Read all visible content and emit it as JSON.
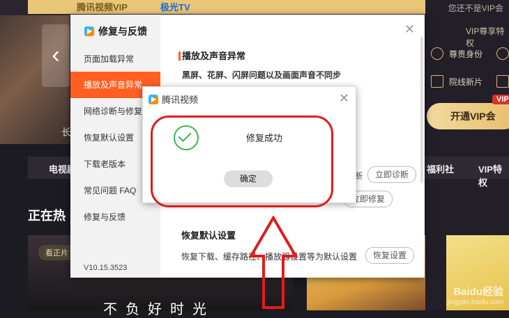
{
  "background": {
    "banner_logo_1": "腾讯视频VIP",
    "banner_logo_2": "极光TV",
    "carousel_caption": "长",
    "vip_hint": "您还不是VIP会",
    "vip_section_title": "VIP尊享特权",
    "vip_rows": [
      {
        "label": "尊贵身份"
      },
      {
        "label": "院线新片"
      }
    ],
    "vip_button": "开通VIP会",
    "vip_tag": "VIP",
    "tabs": [
      "电视剧",
      "福利社",
      "VIP特权"
    ],
    "hot_title": "正在热",
    "watch_badge": "看正片",
    "caption": "不负好时光",
    "watermark_main": "Baidu经验",
    "watermark_sub": "jingyan.baidu.com"
  },
  "dialog": {
    "title": "修复与反馈",
    "nav": [
      {
        "label": "页面加载异常"
      },
      {
        "label": "播放及声音异常"
      },
      {
        "label": "网络诊断与修复"
      },
      {
        "label": "恢复默认设置"
      },
      {
        "label": "下载老版本"
      },
      {
        "label": "常见问题 FAQ"
      },
      {
        "label": "修复与反馈"
      }
    ],
    "version": "V10.15.3523",
    "section1_title": "播放及声音异常",
    "section1_desc": "黑屏、花屏、闪屏问题以及画面声音不同步",
    "diag_partial": "断",
    "diag_button": "立即诊断",
    "repair_button": "立即修复",
    "section2_title": "恢复默认设置",
    "section2_desc": "恢复下载、缓存路径、播放器设置等为默认设置",
    "restore_button": "恢复设置"
  },
  "popup": {
    "title": "腾讯视频",
    "message": "修复成功",
    "ok_button": "确定"
  }
}
